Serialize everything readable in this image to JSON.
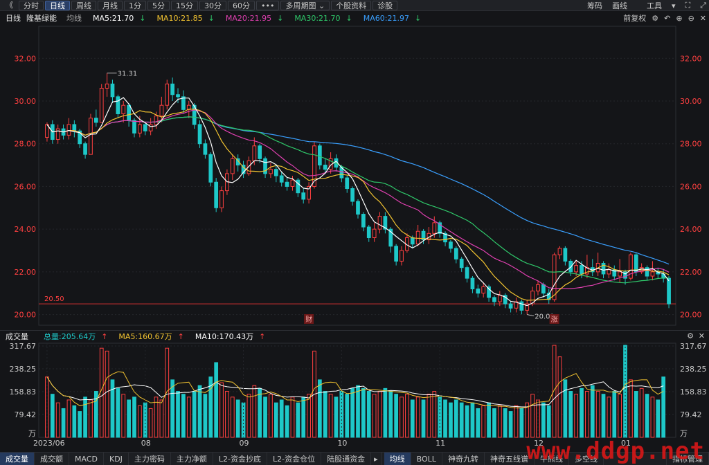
{
  "toolbar": {
    "back_icon": "double-left-arrow-icon",
    "periods": [
      "分时",
      "日线",
      "周线",
      "月线",
      "1分",
      "5分",
      "15分",
      "30分",
      "60分"
    ],
    "active_period": "日线",
    "more": "•••",
    "multi_period": "多周期图",
    "stock_info": "个股资料",
    "diagnose": "诊股",
    "right": [
      "筹码",
      "画线",
      "工具"
    ]
  },
  "indicator_bar": {
    "period": "日线",
    "name": "隆基绿能",
    "avg": "均线",
    "ma5": "MA5:21.70",
    "ma10": "MA10:21.85",
    "ma20": "MA20:21.95",
    "ma30": "MA30:21.70",
    "ma60": "MA60:21.97",
    "restore": "前复权",
    "colors": {
      "ma5": "#ffffff",
      "ma10": "#f2c330",
      "ma20": "#e040b0",
      "ma30": "#2fc86a",
      "ma60": "#3aa0ff",
      "up": "#ff4040",
      "down": "#1ec8c8"
    }
  },
  "price_axis": {
    "ticks": [
      "32.00",
      "30.00",
      "28.00",
      "26.00",
      "24.00",
      "22.00",
      "20.00"
    ],
    "high_mark": "31.31",
    "low_mark": "20.01",
    "last_line": "20.50",
    "badge_cai": "财",
    "badge_zhang": "涨"
  },
  "volume_bar": {
    "title": "成交量",
    "total": "总量:205.64万",
    "ma5": "MA5:160.67万",
    "ma10": "MA10:170.43万",
    "ticks": [
      "317.67",
      "238.25",
      "158.83",
      "79.42"
    ],
    "unit": "万"
  },
  "date_axis": [
    "2023/06",
    "08",
    "09",
    "10",
    "11",
    "12",
    "01"
  ],
  "bottom_tabs_left": [
    "成交量",
    "成交额",
    "MACD",
    "KDJ",
    "主力密码",
    "主力净额",
    "L2-资金抄底",
    "L2-资金仓位",
    "陆股通资金"
  ],
  "bottom_tabs_right": [
    "均线",
    "BOLL",
    "神奇九转",
    "神奇五线谱",
    "牛熊线",
    "多空线"
  ],
  "bottom_manage": "指标管理",
  "watermark": "www.ddgp.net",
  "chart_data": {
    "type": "candlestick",
    "ylim": [
      19.5,
      33.5
    ],
    "candles": [
      [
        28.3,
        28.9,
        28.1,
        29.0
      ],
      [
        28.9,
        28.2,
        28.0,
        29.1
      ],
      [
        28.2,
        28.7,
        28.0,
        28.9
      ],
      [
        28.7,
        28.4,
        28.2,
        28.9
      ],
      [
        28.4,
        28.9,
        28.2,
        29.2
      ],
      [
        28.9,
        28.6,
        28.3,
        29.1
      ],
      [
        28.6,
        28.0,
        27.8,
        28.7
      ],
      [
        28.0,
        27.5,
        27.3,
        28.1
      ],
      [
        27.5,
        29.2,
        27.5,
        29.4
      ],
      [
        29.2,
        29.0,
        28.8,
        29.6
      ],
      [
        29.0,
        30.6,
        29.0,
        30.8
      ],
      [
        30.6,
        30.8,
        30.2,
        31.31
      ],
      [
        30.8,
        30.2,
        29.9,
        31.0
      ],
      [
        30.2,
        29.4,
        29.2,
        30.3
      ],
      [
        29.4,
        29.8,
        29.0,
        30.0
      ],
      [
        29.8,
        29.1,
        28.8,
        29.9
      ],
      [
        29.1,
        28.5,
        28.3,
        29.2
      ],
      [
        28.5,
        28.9,
        28.3,
        29.3
      ],
      [
        28.9,
        28.6,
        28.4,
        29.0
      ],
      [
        28.6,
        28.9,
        28.4,
        29.2
      ],
      [
        28.9,
        29.3,
        28.7,
        29.5
      ],
      [
        29.3,
        29.8,
        29.0,
        30.2
      ],
      [
        29.8,
        30.8,
        29.6,
        31.0
      ],
      [
        30.8,
        30.3,
        30.0,
        31.1
      ],
      [
        30.3,
        30.2,
        29.9,
        30.6
      ],
      [
        30.2,
        29.6,
        29.4,
        30.5
      ],
      [
        29.6,
        29.8,
        29.2,
        30.0
      ],
      [
        29.8,
        28.9,
        28.7,
        29.9
      ],
      [
        28.9,
        28.0,
        27.8,
        29.1
      ],
      [
        28.0,
        27.5,
        27.3,
        28.2
      ],
      [
        27.5,
        26.2,
        26.0,
        27.6
      ],
      [
        26.2,
        25.0,
        24.8,
        26.4
      ],
      [
        25.0,
        25.8,
        24.8,
        26.0
      ],
      [
        25.8,
        26.6,
        25.6,
        26.8
      ],
      [
        26.6,
        27.3,
        26.3,
        27.5
      ],
      [
        27.3,
        27.0,
        26.7,
        27.5
      ],
      [
        27.0,
        26.6,
        26.4,
        27.2
      ],
      [
        26.6,
        27.2,
        26.5,
        27.4
      ],
      [
        27.2,
        27.9,
        27.0,
        28.3
      ],
      [
        27.9,
        27.3,
        27.1,
        28.0
      ],
      [
        27.3,
        26.6,
        26.4,
        27.4
      ],
      [
        26.6,
        26.8,
        26.4,
        27.1
      ],
      [
        26.8,
        26.5,
        26.2,
        27.0
      ],
      [
        26.5,
        26.2,
        26.0,
        26.7
      ],
      [
        26.2,
        26.0,
        25.8,
        26.4
      ],
      [
        26.0,
        26.3,
        25.8,
        26.5
      ],
      [
        26.3,
        25.7,
        25.5,
        26.4
      ],
      [
        25.7,
        25.4,
        25.2,
        25.9
      ],
      [
        25.4,
        26.0,
        25.2,
        26.2
      ],
      [
        26.0,
        27.9,
        25.9,
        28.1
      ],
      [
        27.9,
        27.0,
        26.8,
        28.0
      ],
      [
        27.0,
        26.8,
        26.6,
        27.3
      ],
      [
        26.8,
        27.3,
        26.6,
        27.6
      ],
      [
        27.3,
        26.9,
        26.7,
        27.5
      ],
      [
        26.9,
        26.4,
        26.2,
        27.0
      ],
      [
        26.4,
        25.9,
        25.7,
        26.5
      ],
      [
        25.9,
        25.3,
        25.1,
        26.0
      ],
      [
        25.3,
        24.7,
        24.5,
        25.4
      ],
      [
        24.7,
        24.1,
        23.9,
        24.8
      ],
      [
        24.1,
        23.6,
        23.4,
        24.2
      ],
      [
        23.6,
        24.0,
        23.4,
        24.3
      ],
      [
        24.0,
        24.6,
        23.8,
        24.8
      ],
      [
        24.6,
        24.0,
        23.8,
        24.8
      ],
      [
        24.0,
        23.2,
        22.9,
        24.1
      ],
      [
        23.2,
        22.5,
        22.3,
        23.3
      ],
      [
        22.5,
        23.0,
        22.3,
        23.2
      ],
      [
        23.0,
        23.6,
        22.9,
        23.8
      ],
      [
        23.6,
        23.3,
        23.1,
        23.7
      ],
      [
        23.3,
        23.9,
        23.2,
        24.2
      ],
      [
        23.9,
        23.5,
        23.3,
        24.0
      ],
      [
        23.5,
        23.8,
        23.3,
        24.1
      ],
      [
        23.8,
        24.3,
        23.6,
        24.6
      ],
      [
        24.3,
        23.8,
        23.6,
        24.4
      ],
      [
        23.8,
        23.4,
        23.2,
        23.9
      ],
      [
        23.4,
        23.1,
        22.9,
        23.5
      ],
      [
        23.1,
        22.6,
        22.4,
        23.2
      ],
      [
        22.6,
        22.2,
        22.0,
        22.7
      ],
      [
        22.2,
        21.7,
        21.5,
        22.3
      ],
      [
        21.7,
        21.2,
        21.0,
        21.8
      ],
      [
        21.2,
        21.0,
        20.8,
        21.4
      ],
      [
        21.0,
        21.3,
        20.8,
        21.5
      ],
      [
        21.3,
        20.8,
        20.6,
        21.4
      ],
      [
        20.8,
        20.6,
        20.4,
        20.9
      ],
      [
        20.6,
        20.9,
        20.4,
        21.1
      ],
      [
        20.9,
        20.5,
        20.3,
        21.0
      ],
      [
        20.5,
        20.3,
        20.1,
        20.6
      ],
      [
        20.3,
        20.6,
        20.1,
        20.8
      ],
      [
        20.6,
        20.2,
        20.01,
        20.7
      ],
      [
        20.2,
        20.5,
        20.0,
        20.7
      ],
      [
        20.5,
        21.1,
        20.4,
        21.3
      ],
      [
        21.1,
        21.4,
        20.9,
        21.6
      ],
      [
        21.4,
        21.0,
        20.8,
        21.5
      ],
      [
        21.0,
        20.7,
        20.5,
        21.2
      ],
      [
        20.7,
        22.8,
        20.6,
        22.9
      ],
      [
        22.8,
        23.1,
        22.6,
        23.2
      ],
      [
        23.1,
        22.5,
        22.3,
        23.2
      ],
      [
        22.5,
        22.0,
        21.8,
        22.6
      ],
      [
        22.0,
        22.3,
        21.8,
        22.5
      ],
      [
        22.3,
        21.9,
        21.7,
        22.5
      ],
      [
        21.9,
        22.2,
        21.7,
        22.8
      ],
      [
        22.2,
        22.0,
        21.8,
        22.6
      ],
      [
        22.0,
        22.4,
        21.8,
        22.9
      ],
      [
        22.4,
        21.9,
        21.7,
        22.5
      ],
      [
        21.9,
        22.1,
        21.7,
        22.4
      ],
      [
        22.1,
        21.8,
        21.6,
        22.3
      ],
      [
        21.8,
        22.0,
        21.5,
        22.6
      ],
      [
        22.0,
        21.7,
        21.4,
        22.1
      ],
      [
        21.7,
        22.8,
        21.6,
        22.9
      ],
      [
        22.8,
        22.0,
        21.8,
        22.9
      ],
      [
        22.0,
        22.2,
        21.9,
        22.4
      ],
      [
        22.2,
        21.8,
        21.6,
        22.3
      ],
      [
        21.8,
        22.0,
        21.6,
        22.5
      ],
      [
        22.0,
        21.9,
        21.7,
        22.2
      ],
      [
        21.9,
        21.7,
        21.5,
        22.1
      ],
      [
        21.7,
        20.5,
        20.3,
        21.8
      ]
    ],
    "volumes": [
      210,
      150,
      120,
      100,
      130,
      110,
      90,
      140,
      130,
      160,
      310,
      300,
      200,
      170,
      150,
      130,
      140,
      110,
      120,
      100,
      140,
      130,
      310,
      200,
      160,
      150,
      140,
      160,
      180,
      150,
      210,
      260,
      190,
      160,
      140,
      130,
      120,
      150,
      180,
      170,
      140,
      150,
      120,
      130,
      110,
      140,
      120,
      140,
      150,
      300,
      200,
      160,
      150,
      140,
      160,
      150,
      170,
      180,
      170,
      160,
      150,
      160,
      170,
      160,
      150,
      140,
      150,
      130,
      140,
      130,
      150,
      160,
      140,
      130,
      120,
      130,
      120,
      110,
      120,
      100,
      110,
      120,
      100,
      110,
      100,
      90,
      110,
      100,
      120,
      150,
      130,
      120,
      110,
      320,
      280,
      200,
      160,
      150,
      170,
      160,
      180,
      160,
      150,
      140,
      160,
      150,
      320,
      200,
      160,
      170,
      150,
      140,
      130,
      210
    ],
    "ma_lines": [
      "ma5",
      "ma10",
      "ma20",
      "ma30",
      "ma60"
    ]
  }
}
